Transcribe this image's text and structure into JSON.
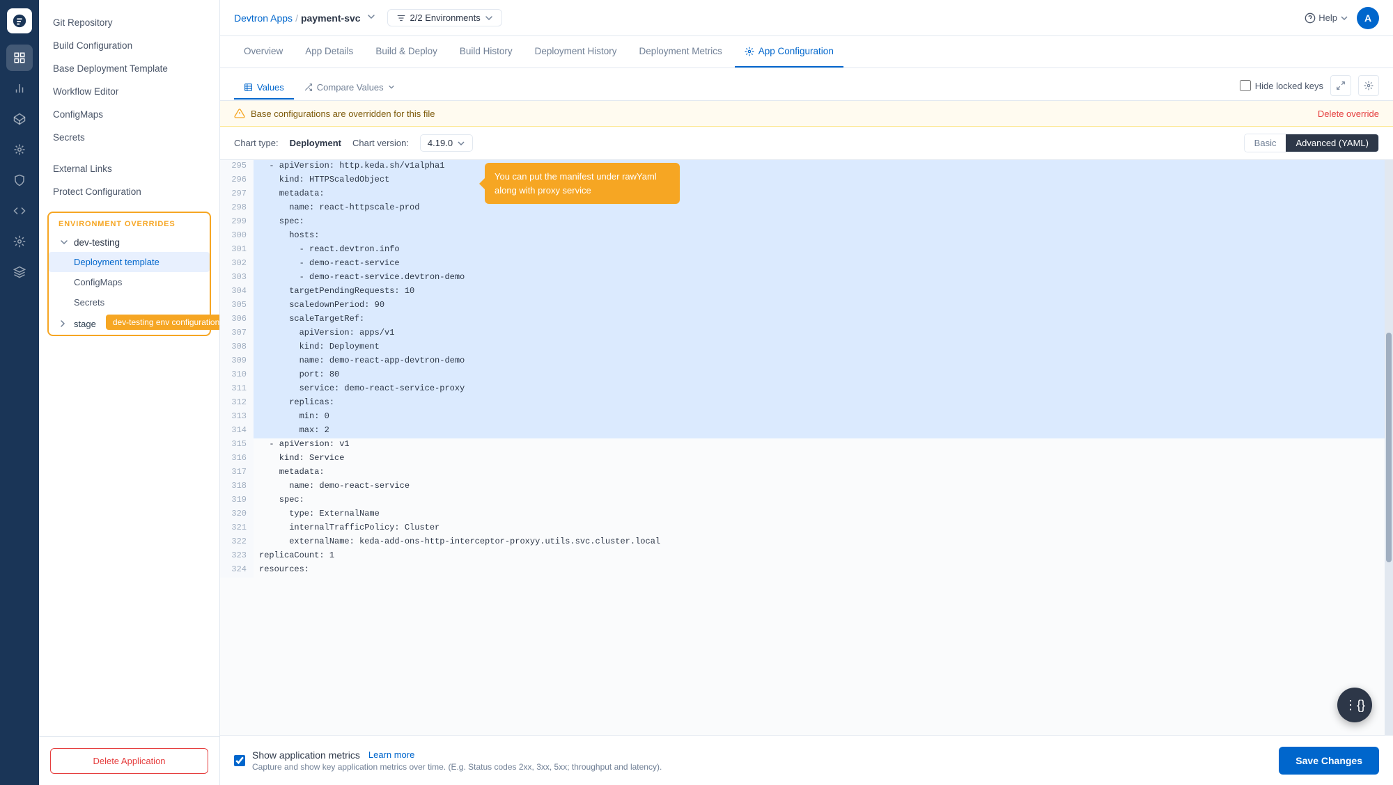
{
  "breadcrumb": {
    "app": "Devtron Apps",
    "sep": "/",
    "service": "payment-svc",
    "env_count": "2/2 Environments"
  },
  "topbar": {
    "help": "Help",
    "avatar": "A"
  },
  "nav_tabs": [
    {
      "id": "overview",
      "label": "Overview"
    },
    {
      "id": "app-details",
      "label": "App Details"
    },
    {
      "id": "build-deploy",
      "label": "Build & Deploy"
    },
    {
      "id": "build-history",
      "label": "Build History"
    },
    {
      "id": "deployment-history",
      "label": "Deployment History"
    },
    {
      "id": "deployment-metrics",
      "label": "Deployment Metrics"
    },
    {
      "id": "app-configuration",
      "label": "App Configuration",
      "active": true
    }
  ],
  "content_tabs": {
    "values": "Values",
    "compare": "Compare Values",
    "hide_locked": "Hide locked keys"
  },
  "alert": {
    "message": "Base configurations are overridden for this file",
    "action": "Delete override"
  },
  "chart": {
    "type_label": "Chart type:",
    "type_value": "Deployment",
    "version_label": "Chart version:",
    "version_value": "4.19.0",
    "mode_basic": "Basic",
    "mode_advanced": "Advanced (YAML)"
  },
  "sidebar": {
    "items": [
      {
        "id": "git-repo",
        "label": "Git Repository"
      },
      {
        "id": "build-config",
        "label": "Build Configuration"
      },
      {
        "id": "base-deployment",
        "label": "Base Deployment Template"
      },
      {
        "id": "workflow-editor",
        "label": "Workflow Editor"
      },
      {
        "id": "configmaps",
        "label": "ConfigMaps"
      },
      {
        "id": "secrets",
        "label": "Secrets"
      },
      {
        "id": "external-links",
        "label": "External Links"
      },
      {
        "id": "protect-config",
        "label": "Protect Configuration"
      }
    ],
    "env_overrides_label": "ENVIRONMENT OVERRIDES",
    "dev_testing": "dev-testing",
    "sub_items": [
      {
        "id": "deployment-template",
        "label": "Deployment template",
        "active": true
      },
      {
        "id": "configmaps-env",
        "label": "ConfigMaps"
      },
      {
        "id": "secrets-env",
        "label": "Secrets"
      }
    ],
    "stage": "stage",
    "stage_tooltip": "dev-testing env configurations",
    "delete_app": "Delete Application"
  },
  "code_lines": [
    {
      "num": "295",
      "content": "  - apiVersion: http.keda.sh/v1alpha1",
      "highlight": true
    },
    {
      "num": "296",
      "content": "    kind: HTTPScaledObject",
      "highlight": true
    },
    {
      "num": "297",
      "content": "    metadata:",
      "highlight": true
    },
    {
      "num": "298",
      "content": "      name: react-httpscale-prod",
      "highlight": true
    },
    {
      "num": "299",
      "content": "    spec:",
      "highlight": true
    },
    {
      "num": "300",
      "content": "      hosts:",
      "highlight": true
    },
    {
      "num": "301",
      "content": "        - react.devtron.info",
      "highlight": true
    },
    {
      "num": "302",
      "content": "        - demo-react-service",
      "highlight": true
    },
    {
      "num": "303",
      "content": "        - demo-react-service.devtron-demo",
      "highlight": true
    },
    {
      "num": "304",
      "content": "      targetPendingRequests: 10",
      "highlight": true
    },
    {
      "num": "305",
      "content": "      scaledownPeriod: 90",
      "highlight": true
    },
    {
      "num": "306",
      "content": "      scaleTargetRef:",
      "highlight": true
    },
    {
      "num": "307",
      "content": "        apiVersion: apps/v1",
      "highlight": true
    },
    {
      "num": "308",
      "content": "        kind: Deployment",
      "highlight": true
    },
    {
      "num": "309",
      "content": "        name: demo-react-app-devtron-demo",
      "highlight": true
    },
    {
      "num": "310",
      "content": "        port: 80",
      "highlight": true
    },
    {
      "num": "311",
      "content": "        service: demo-react-service-proxy",
      "highlight": true
    },
    {
      "num": "312",
      "content": "      replicas:",
      "highlight": true
    },
    {
      "num": "313",
      "content": "        min: 0",
      "highlight": true
    },
    {
      "num": "314",
      "content": "        max: 2",
      "highlight": true
    },
    {
      "num": "315",
      "content": "  - apiVersion: v1",
      "highlight": false
    },
    {
      "num": "316",
      "content": "    kind: Service",
      "highlight": false
    },
    {
      "num": "317",
      "content": "    metadata:",
      "highlight": false
    },
    {
      "num": "318",
      "content": "      name: demo-react-service",
      "highlight": false
    },
    {
      "num": "319",
      "content": "    spec:",
      "highlight": false
    },
    {
      "num": "320",
      "content": "      type: ExternalName",
      "highlight": false
    },
    {
      "num": "321",
      "content": "      internalTrafficPolicy: Cluster",
      "highlight": false
    },
    {
      "num": "322",
      "content": "      externalName: keda-add-ons-http-interceptor-proxyy.utils.svc.cluster.local",
      "highlight": false
    },
    {
      "num": "323",
      "content": "replicaCount: 1",
      "highlight": false
    },
    {
      "num": "324",
      "content": "resources:",
      "highlight": false
    }
  ],
  "tooltip": {
    "text": "You can put the manifest under rawYaml along with proxy service"
  },
  "bottom": {
    "checkbox_label": "Show application metrics",
    "learn_more": "Learn more",
    "desc": "Capture and show key application metrics over time. (E.g. Status codes 2xx, 3xx, 5xx; throughput and latency).",
    "save_btn": "Save Changes"
  }
}
